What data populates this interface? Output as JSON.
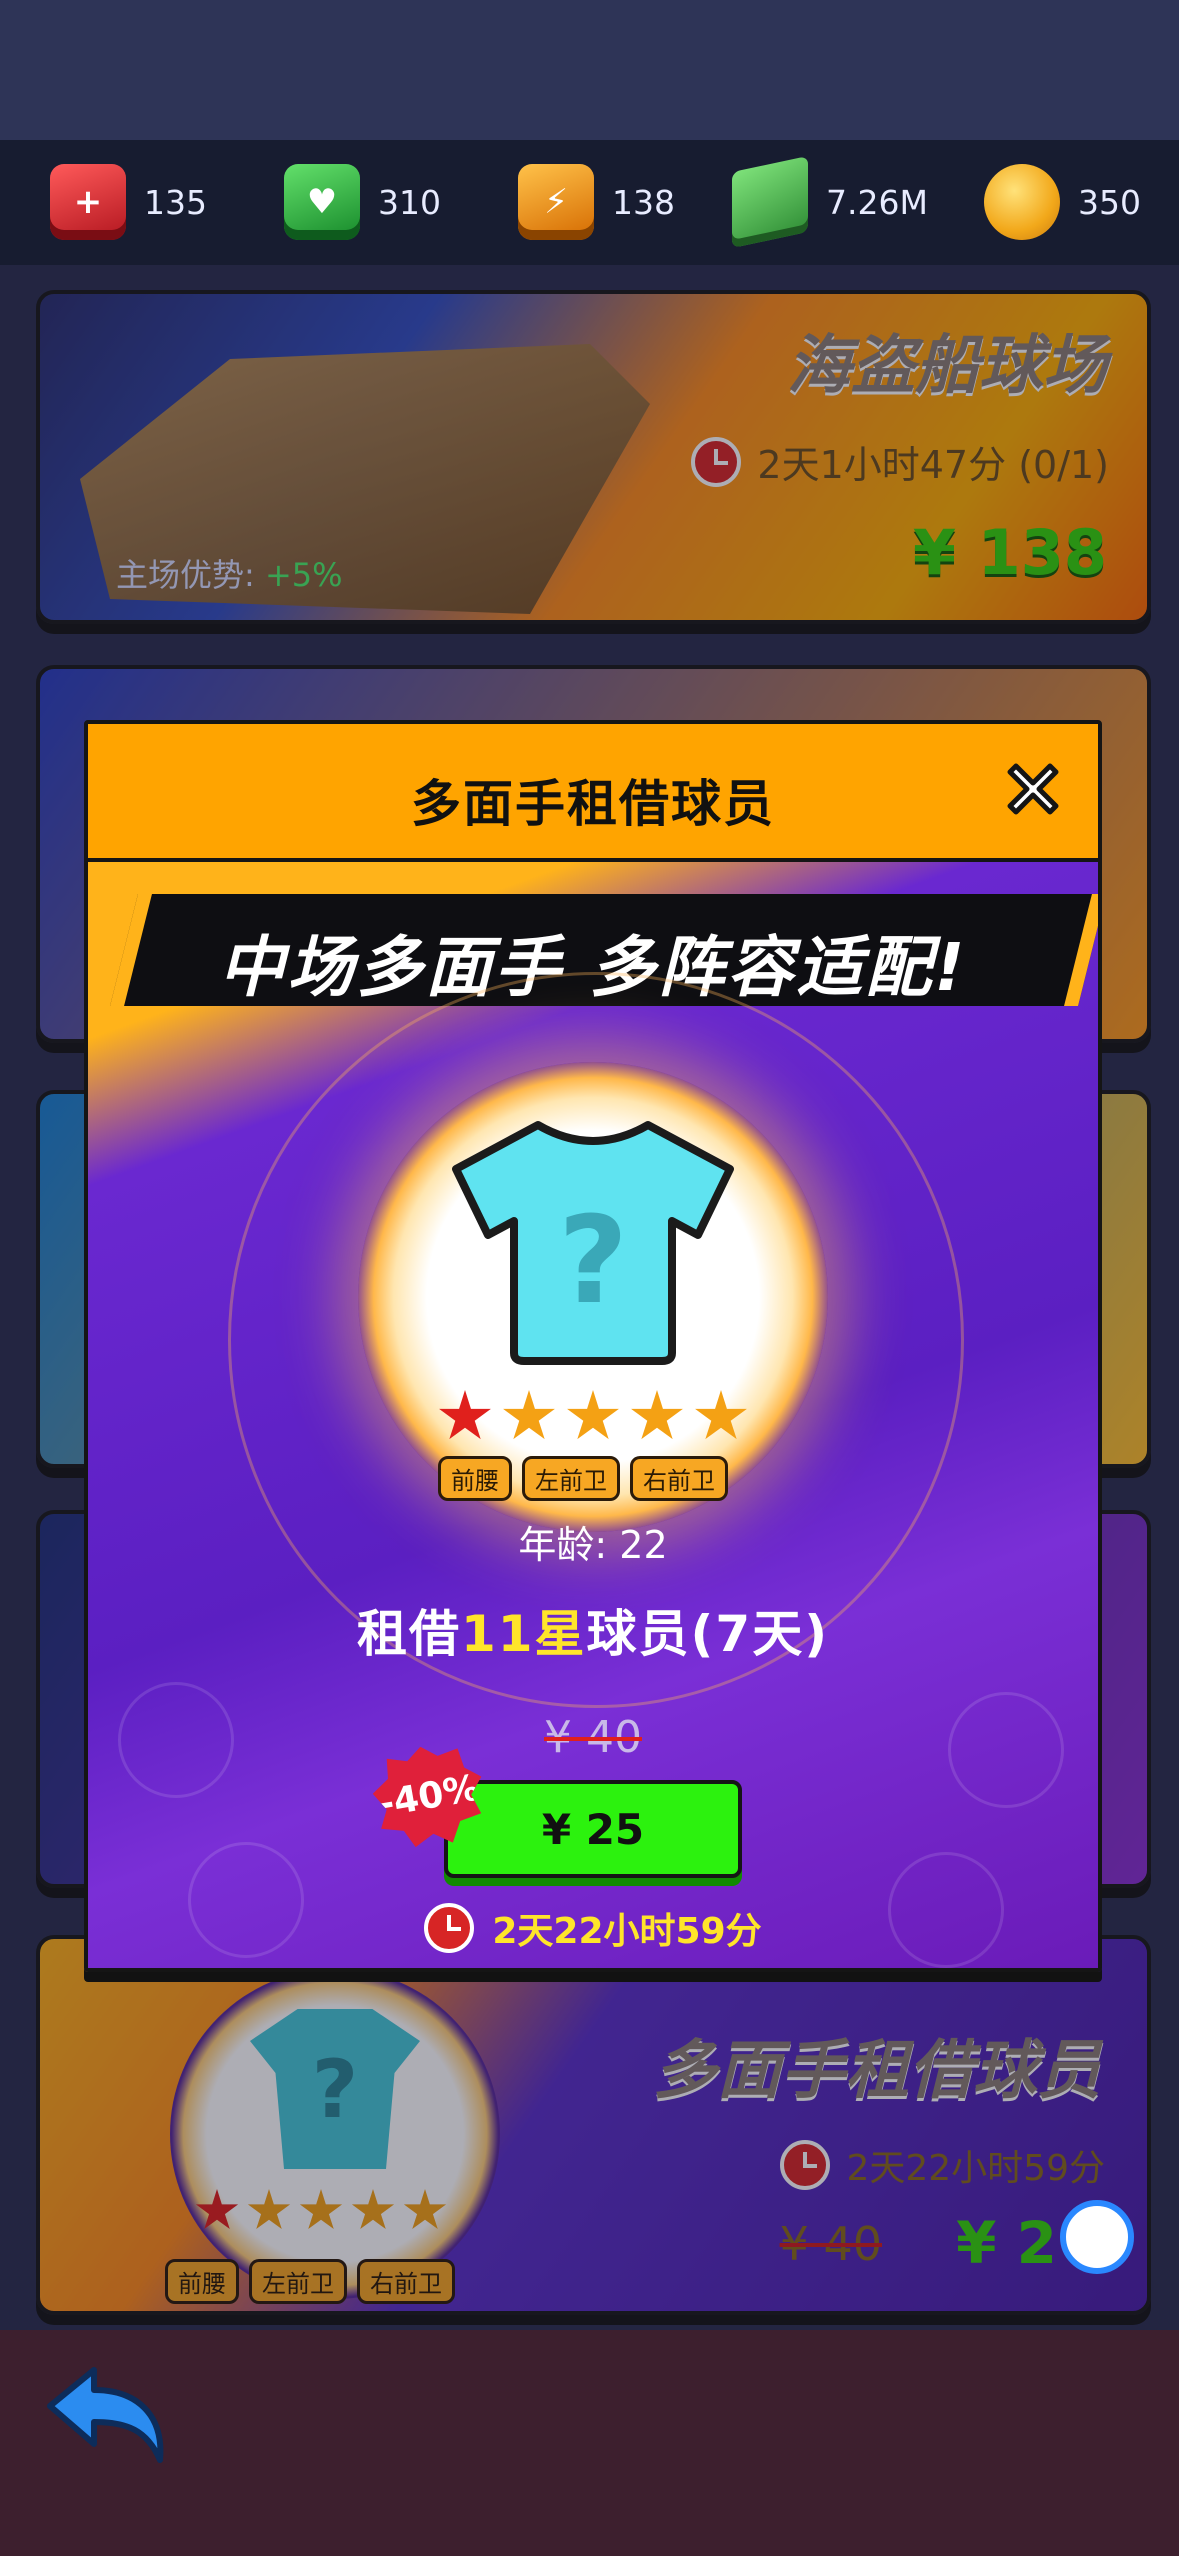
{
  "resources": [
    {
      "icon": "health-crate-icon",
      "value": "135",
      "color": "#d92b2b"
    },
    {
      "icon": "heart-crate-icon",
      "value": "310",
      "color": "#2fae3f"
    },
    {
      "icon": "energy-crate-icon",
      "value": "138",
      "color": "#ef8a10"
    },
    {
      "icon": "cash-stack-icon",
      "value": "7.26M",
      "color": "#3aa843"
    },
    {
      "icon": "gold-coin-icon",
      "value": "350",
      "color": "#f2a81a"
    }
  ],
  "shop_cards": {
    "pirate_stadium": {
      "title": "海盗船球场",
      "timer": "2天1小时47分 (0/1)",
      "price": "¥ 138",
      "home_advantage_label": "主场优势:",
      "home_advantage_value": "+5%"
    },
    "versatile_lease": {
      "title": "多面手租借球员",
      "timer": "2天22小时59分",
      "old_price": "¥ 40",
      "new_price": "¥ 2",
      "tags": [
        "前腰",
        "左前卫",
        "右前卫"
      ]
    }
  },
  "dialog": {
    "title": "多面手租借球员",
    "banner": "中场多面手 多阵容适配!",
    "player_placeholder": "?",
    "stars": {
      "red": 1,
      "gold": 4
    },
    "positions": [
      "前腰",
      "左前卫",
      "右前卫"
    ],
    "age_label": "年龄:",
    "age_value": "22",
    "lease_prefix": "租借",
    "lease_highlight": "11星",
    "lease_suffix": "球员(7天)",
    "old_price": "¥ 40",
    "discount": "-40%",
    "buy_price": "¥ 25",
    "timer": "2天22小时59分"
  },
  "colors": {
    "accent_orange": "#ffa400",
    "buy_green": "#2cf20e",
    "dialog_purple": "#5b1fc2",
    "highlight_yellow": "#ffe52a",
    "discount_red": "#e0203a"
  }
}
